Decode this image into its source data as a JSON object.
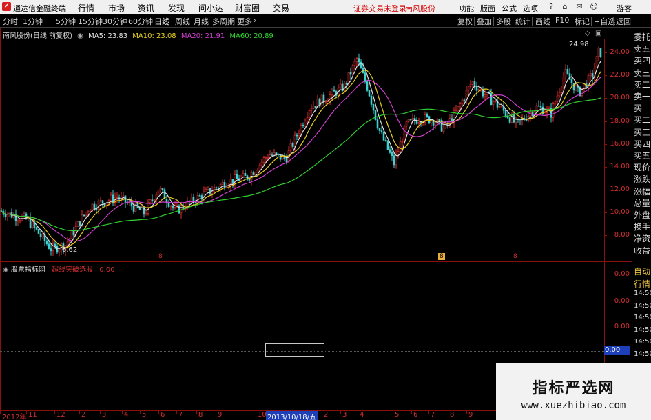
{
  "titlebar": {
    "app_name": "通达信金融终端",
    "menus": [
      "行情",
      "市场",
      "资讯",
      "发现",
      "问小达",
      "财富圈",
      "交易"
    ],
    "notice": "证券交易未登录",
    "stock_notice": "南风股份",
    "right_menus": [
      "功能",
      "版面",
      "公式",
      "选项"
    ],
    "guest": "游客"
  },
  "toolbar": {
    "periods": [
      "分时",
      "1分钟",
      "5分钟",
      "15分钟",
      "30分钟",
      "60分钟",
      "日线",
      "周线",
      "月线",
      "多周期",
      "更多"
    ],
    "active": "日线",
    "right_items": [
      "复权",
      "叠加",
      "多股",
      "统计",
      "画线",
      "F10",
      "标记",
      "+自选",
      "返回"
    ]
  },
  "main_chart": {
    "stock_title": "南风股份(日线 前复权)",
    "ma_legend": [
      {
        "label": "MA5: 23.83",
        "color": "#e0e0e0"
      },
      {
        "label": "MA10: 23.08",
        "color": "#e8d020"
      },
      {
        "label": "MA20: 21.91",
        "color": "#d040d0"
      },
      {
        "label": "MA60: 20.89",
        "color": "#30d030"
      }
    ],
    "high_label": "24.98",
    "low_label": "6.62",
    "y_ticks": [
      "24.00",
      "22.00",
      "20.00",
      "18.00",
      "16.00",
      "14.00",
      "12.00",
      "10.00",
      "8.00"
    ],
    "markers": [
      "8",
      "8",
      "8"
    ]
  },
  "sub_chart": {
    "title": "股票指标网",
    "indicator": "超线突破选股",
    "value": "0.00",
    "y_ticks": [
      "0.00",
      "0.00",
      "0.00"
    ],
    "current_value": "0.00"
  },
  "side_panel": {
    "items": [
      "委托",
      "卖五",
      "卖四",
      "卖三",
      "卖二",
      "卖一",
      "买一",
      "买二",
      "买三",
      "买四",
      "买五",
      "现价",
      "涨跌",
      "涨幅",
      "总量",
      "外盘",
      "换手",
      "净资",
      "收益"
    ],
    "bottom_items": [
      "自动",
      "行情",
      "14:50",
      "14:50",
      "14:50",
      "14:50",
      "14:50",
      "14:50",
      "14:50"
    ]
  },
  "date_axis": {
    "labels": [
      "2012年",
      "11",
      "12",
      "2",
      "3",
      "4",
      "5",
      "6",
      "7",
      "8",
      "9",
      "10",
      "12",
      "2",
      "3",
      "4",
      "5",
      "6",
      "7",
      "8",
      "9"
    ],
    "current": "2013/10/18/五"
  },
  "watermark": {
    "title": "指标严选网",
    "url": "www.xuezhibiao.com"
  },
  "colors": {
    "up": "#e03030",
    "down": "#40d0d0",
    "ma5": "#e0e0e0",
    "ma10": "#e8d020",
    "ma20": "#d040d0",
    "ma60": "#30d030",
    "border": "#8a1010"
  }
}
